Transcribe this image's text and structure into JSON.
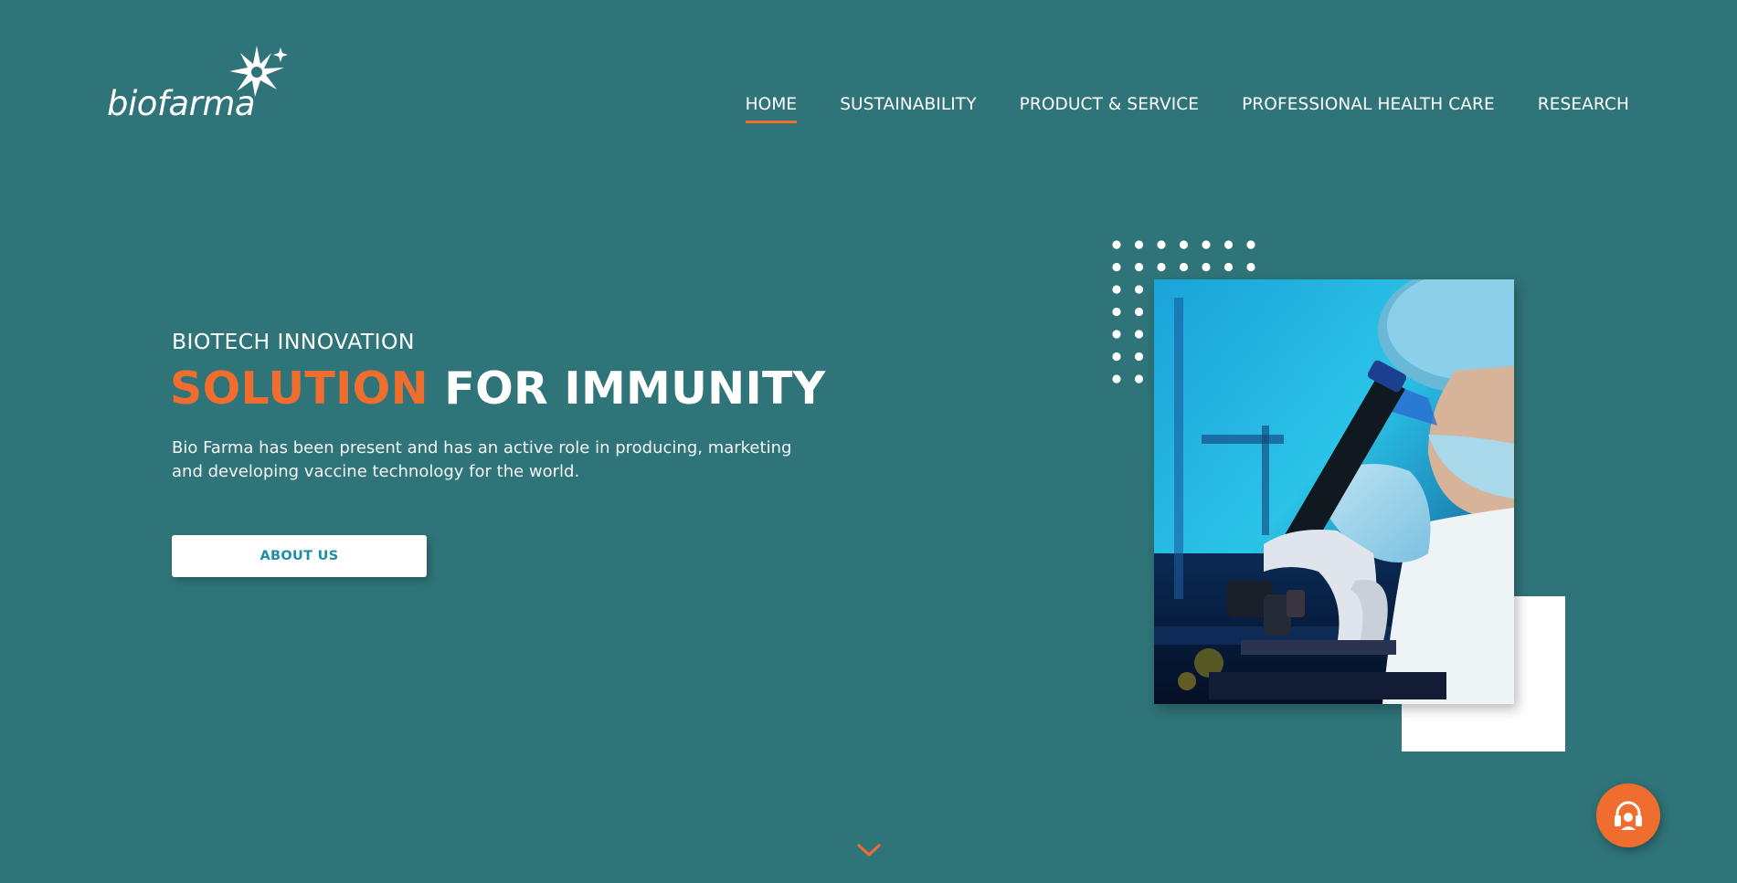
{
  "brand": {
    "logo_text": "biofarma",
    "accent_color": "#ef6d2e",
    "background_color": "#2f7478"
  },
  "nav": {
    "items": [
      {
        "label": "HOME",
        "active": true
      },
      {
        "label": "SUSTAINABILITY",
        "active": false
      },
      {
        "label": "PRODUCT & SERVICE",
        "active": false
      },
      {
        "label": "PROFESSIONAL HEALTH CARE",
        "active": false
      },
      {
        "label": "RESEARCH",
        "active": false
      }
    ]
  },
  "hero": {
    "eyebrow": "BIOTECH INNOVATION",
    "title_accent": "SOLUTION",
    "title_rest": "FOR IMMUNITY",
    "description_line1": "Bio Farma has been present and has an active role in producing, marketing",
    "description_line2": "and developing vaccine technology  for the world.",
    "cta_label": "ABOUT US"
  },
  "icons": {
    "scroll": "chevron-down-icon",
    "support": "headset-icon"
  }
}
